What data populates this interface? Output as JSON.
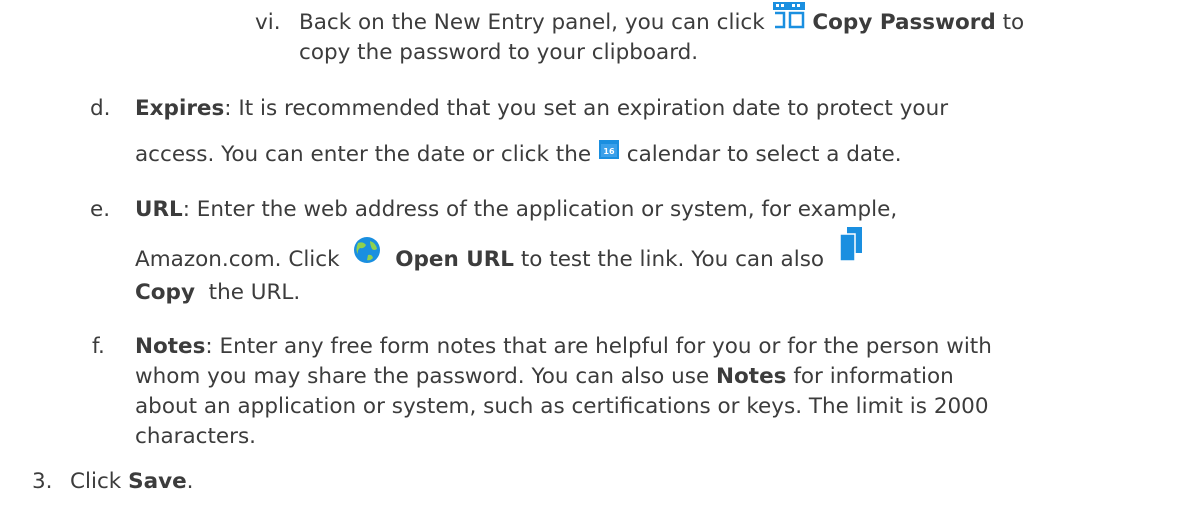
{
  "items": {
    "vi": {
      "marker": "vi.",
      "line1_a": "Back on the New Entry panel, you can click",
      "line1_b": "Copy Password",
      "line1_c": "to",
      "line2": "copy the password to your clipboard.",
      "icon": "copy-password-icon"
    },
    "d": {
      "marker": "d.",
      "term": "Expires",
      "line1": ": It is recommended that you set an expiration date to protect your",
      "line2_a": "access. You can enter the date or click the",
      "line2_b": "calendar to select a date.",
      "icon": "calendar-icon"
    },
    "e": {
      "marker": "e.",
      "term": "URL",
      "line1": ": Enter the web address of the application or system, for example,",
      "line2_a": "Amazon.com. Click",
      "line2_b": "Open URL",
      "line2_c": "to test the link. You can also",
      "line3_a": "Copy",
      "line3_b": "the URL.",
      "icon_open": "globe-icon",
      "icon_copy": "copy-icon"
    },
    "f": {
      "marker": "f.",
      "term": "Notes",
      "line1": ": Enter any free form notes that are helpful for you or for the person with",
      "line2": "whom you may share the password. You can also use",
      "line2_b": "Notes",
      "line2_c": "for information",
      "line3": "about an application or system, such as certifications or keys. The limit is 2000",
      "line4": "characters."
    },
    "step3": {
      "marker": "3.",
      "text_a": "Click",
      "text_b": "Save",
      "text_c": "."
    }
  },
  "colors": {
    "text": "#3c3c3c",
    "icon_blue": "#1a8fe0"
  }
}
